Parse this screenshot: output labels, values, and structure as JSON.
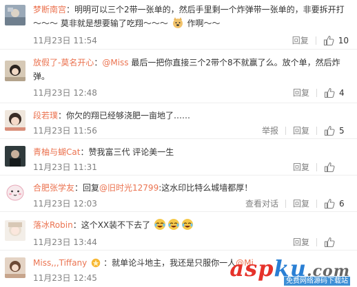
{
  "comments": [
    {
      "user": "梦断南宫",
      "text_a": "：明明可以三个2带一张单的，然后手里剩一个炸弹带一张单的，非要拆开打～～～ 莫非就是想要输了吃翔～～～",
      "text_b": " 作啊～～",
      "time": "11月23日 11:54",
      "reply": "回复",
      "likes": "10",
      "avatar": "avatar-photo-icon",
      "emoji": "doge-icon"
    },
    {
      "user": "放假了-莫名开心",
      "text_a": "：",
      "mention": "@Miss",
      "text_b": " 最后一把你直接三个2带个8不就赢了么。放个单，然后炸弹。",
      "time": "11月23日 12:48",
      "reply": "回复",
      "likes": "4",
      "avatar": "avatar-photo-icon"
    },
    {
      "user": "段若璞",
      "text_a": "：你欠的翔已经够浇肥一亩地了……",
      "time": "11月23日 11:56",
      "report": "举报",
      "reply": "回复",
      "likes": "5",
      "avatar": "avatar-photo-icon"
    },
    {
      "user": "青柚与蝴Cat",
      "text_a": "：赞我富三代 评论美一生",
      "time": "11月23日 11:31",
      "reply": "回复",
      "likes": "",
      "avatar": "avatar-photo-icon"
    },
    {
      "user": "合肥张学友",
      "text_a": "：回复",
      "mention": "@旧时光12799",
      "text_b": ":这水印比特么城墙都厚！",
      "time": "11月23日 12:03",
      "view_convo": "查看对话",
      "reply": "回复",
      "likes": "6",
      "avatar": "avatar-cartoon-icon"
    },
    {
      "user": "落冰Robin",
      "text_a": "：这个XX装不下去了",
      "time": "11月23日 13:44",
      "reply": "回复",
      "likes": "",
      "avatar": "avatar-photo-icon",
      "emoji": "laugh-cry-icon"
    },
    {
      "user": "Miss,,,Tiffany",
      "text_a": "：就单论斗地主，我还是只服你一人",
      "mention": "@Mi",
      "time": "11月23日 12:45",
      "avatar": "avatar-photo-icon",
      "user_badge": "badge-icon"
    }
  ],
  "watermark": {
    "main_a": "asp",
    "main_b": "ku",
    "main_c": ".com",
    "sub": "免费网络源码下载站",
    "logo": "aspku-watermark-logo"
  },
  "colors": {
    "username": "#eb7350",
    "meta": "#808080",
    "text": "#333333"
  }
}
